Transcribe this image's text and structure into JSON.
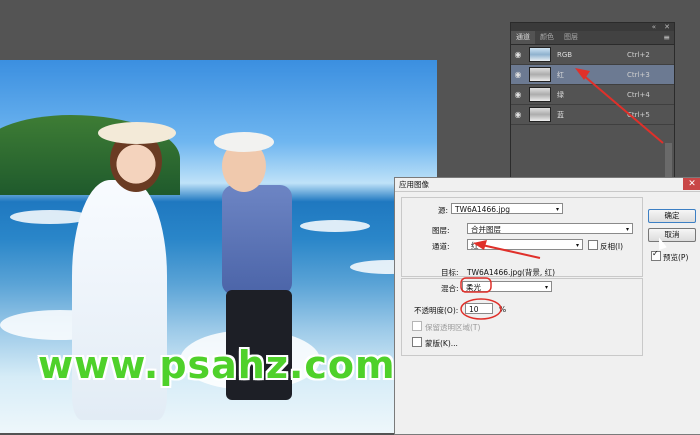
{
  "channels_panel": {
    "tabs": [
      "通道",
      "颜色",
      "图层"
    ],
    "active_tab": 0,
    "rows": [
      {
        "name": "RGB",
        "shortcut": "Ctrl+2",
        "selected": false
      },
      {
        "name": "红",
        "shortcut": "Ctrl+3",
        "selected": true
      },
      {
        "name": "绿",
        "shortcut": "Ctrl+4",
        "selected": false
      },
      {
        "name": "蓝",
        "shortcut": "Ctrl+5",
        "selected": false
      }
    ]
  },
  "dialog": {
    "title": "应用图像",
    "source_label": "源:",
    "source_value": "TW6A1466.jpg",
    "layer_label": "图层:",
    "layer_value": "合并图层",
    "channel_label": "通道:",
    "channel_value": "红",
    "invert_label": "反相(I)",
    "target_label": "目标:",
    "target_value": "TW6A1466.jpg(背景, 红)",
    "blend_label": "混合:",
    "blend_value": "柔光",
    "opacity_label": "不透明度(O):",
    "opacity_value": "10",
    "opacity_unit": "%",
    "preserve_label": "保留透明区域(T)",
    "mask_label": "蒙版(K)...",
    "ok_label": "确定",
    "cancel_label": "取消",
    "preview_label": "预览(P)",
    "preview_checked": true
  },
  "watermark": {
    "text": "www.psahz.com"
  },
  "colors": {
    "annotation": "#e0302a",
    "watermark": "#4fd12a",
    "selected_channel": "#6c7a92"
  }
}
